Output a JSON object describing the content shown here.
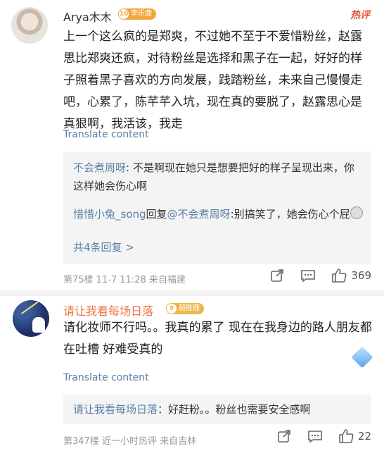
{
  "comments": [
    {
      "username": "Arya木木",
      "badge_level": "10",
      "badge_text": "李乐鹿",
      "hot_label": "热评",
      "body": "上一个这么疯的是郑爽，不过她不至于不爱惜粉丝，赵露思比郑爽还疯，对待粉丝是选择和黑子在一起，好好的样子照着黑子喜欢的方向发展，践踏粉丝，未来自己慢慢走吧，心累了，陈芊芊入坑，现在真的要脱了，赵露思心是真狠啊，我活该，我走",
      "translate": "Translate content",
      "replies": [
        {
          "name": "不会煮周呀",
          "sep": ": ",
          "text": "不是啊现在她只是想要把好的样子呈现出来，你这样她会伤心啊"
        },
        {
          "name": "惜惜小兔_song",
          "mid": "回复",
          "target": "@不会煮周呀",
          "sep": ":",
          "text": "别搞笑了，她会伤心个屁"
        }
      ],
      "more_replies": "共4条回复 >",
      "meta": "第75楼  11-7 11:28  来自福建",
      "like_count": "369"
    },
    {
      "username": "请让我看每场日落",
      "badge_level": "9",
      "badge_text": "超胜鹿",
      "body": "请化妆师不行吗。。我真的累了 现在在我身边的路人朋友都在吐槽 好难受真的",
      "translate": "Translate content",
      "replies": [
        {
          "name": "请让我看每场日落",
          "sep": "：",
          "text": "好赶粉。。粉丝也需要安全感啊"
        }
      ],
      "meta": "第347楼  近一小时热评  来自吉林",
      "like_count": "22"
    }
  ],
  "icons": {
    "share": "share-icon",
    "comment": "comment-icon",
    "like": "like-icon"
  },
  "colors": {
    "link": "#5a7fa8",
    "hot": "#e8553b",
    "highlight_name": "#eb7340"
  }
}
